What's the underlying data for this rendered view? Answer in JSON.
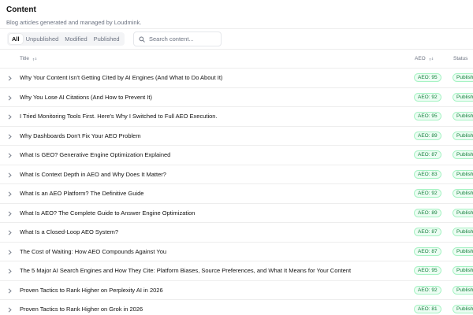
{
  "header": {
    "title": "Content",
    "subtitle": "Blog articles generated and managed by Loudmink."
  },
  "tabs": [
    {
      "label": "All",
      "active": true
    },
    {
      "label": "Unpublished",
      "active": false
    },
    {
      "label": "Modified",
      "active": false
    },
    {
      "label": "Published",
      "active": false
    }
  ],
  "search": {
    "placeholder": "Search content...",
    "value": ""
  },
  "table": {
    "columns": {
      "title": "Title",
      "aeo": "AEO",
      "status": "Status"
    },
    "rows": [
      {
        "title": "Why Your Content Isn't Getting Cited by AI Engines (And What to Do About It)",
        "aeo": "AEO: 95",
        "status": "Published"
      },
      {
        "title": "Why You Lose AI Citations (And How to Prevent It)",
        "aeo": "AEO: 92",
        "status": "Published"
      },
      {
        "title": "I Tried Monitoring Tools First. Here's Why I Switched to Full AEO Execution.",
        "aeo": "AEO: 95",
        "status": "Published"
      },
      {
        "title": "Why Dashboards Don't Fix Your AEO Problem",
        "aeo": "AEO: 89",
        "status": "Published"
      },
      {
        "title": "What Is GEO? Generative Engine Optimization Explained",
        "aeo": "AEO: 87",
        "status": "Published"
      },
      {
        "title": "What Is Context Depth in AEO and Why Does It Matter?",
        "aeo": "AEO: 83",
        "status": "Published"
      },
      {
        "title": "What Is an AEO Platform? The Definitive Guide",
        "aeo": "AEO: 92",
        "status": "Published"
      },
      {
        "title": "What Is AEO? The Complete Guide to Answer Engine Optimization",
        "aeo": "AEO: 89",
        "status": "Published"
      },
      {
        "title": "What Is a Closed-Loop AEO System?",
        "aeo": "AEO: 87",
        "status": "Published"
      },
      {
        "title": "The Cost of Waiting: How AEO Compounds Against You",
        "aeo": "AEO: 87",
        "status": "Published"
      },
      {
        "title": "The 5 Major AI Search Engines and How They Cite: Platform Biases, Source Preferences, and What It Means for Your Content",
        "aeo": "AEO: 95",
        "status": "Published"
      },
      {
        "title": "Proven Tactics to Rank Higher on Perplexity AI in 2026",
        "aeo": "AEO: 92",
        "status": "Published"
      },
      {
        "title": "Proven Tactics to Rank Higher on Grok in 2026",
        "aeo": "AEO: 81",
        "status": "Published"
      }
    ]
  },
  "colors": {
    "badge_bg": "#ecfdf3",
    "badge_border": "#a7f3c4",
    "badge_text": "#15803d",
    "divider": "#ececec"
  },
  "icons": {
    "search": "search-icon",
    "sort": "sort-arrows-icon",
    "row_expand": "chevron-right-icon"
  }
}
